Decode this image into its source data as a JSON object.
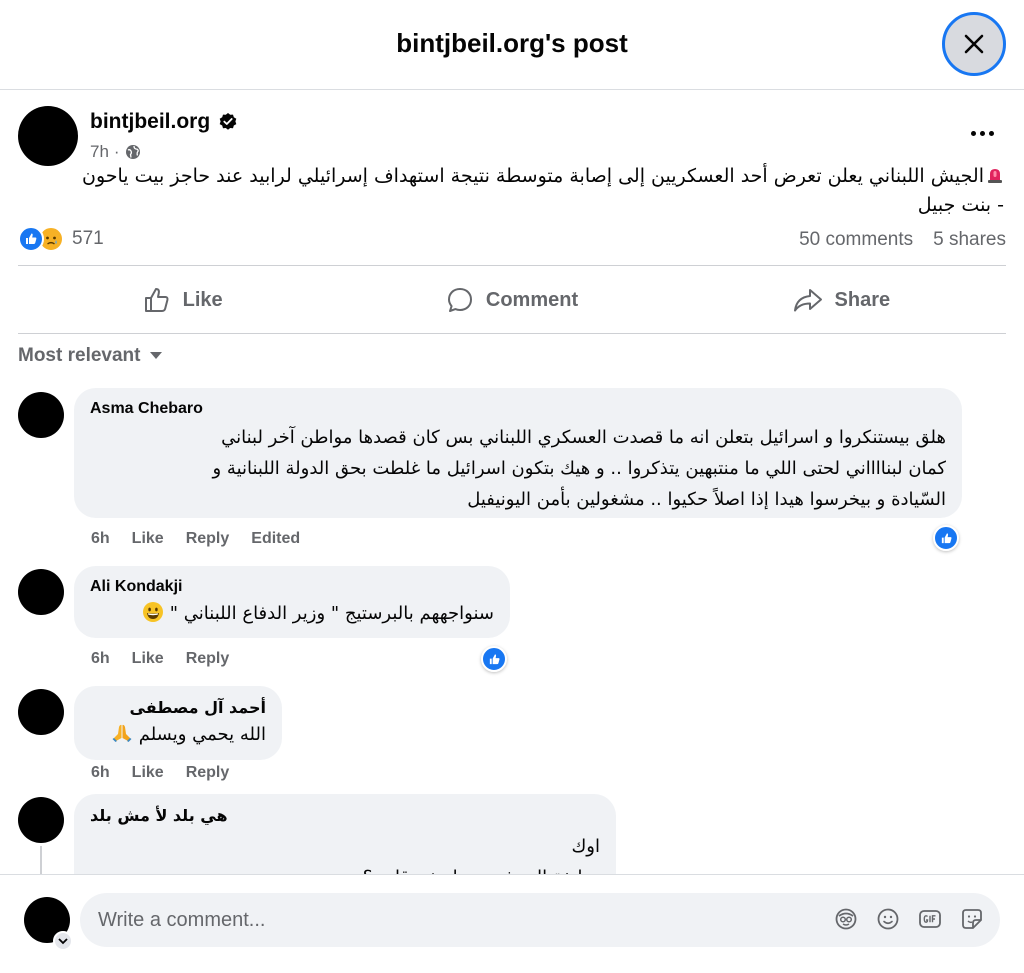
{
  "header": {
    "title": "bintjbeil.org's post"
  },
  "post": {
    "author": "bintjbeil.org",
    "time": "7h",
    "separator": "·",
    "text_line1": "الجيش اللبناني يعلن تعرض أحد العسكريين إلى إصابة متوسطة نتيجة استهداف إسرائيلي لرابيد عند حاجز بيت ياحون",
    "text_line2": "- بنت جبيل",
    "reaction_count": "571",
    "comments_count": "50 comments",
    "shares_count": "5 shares"
  },
  "actions": {
    "like": "Like",
    "comment": "Comment",
    "share": "Share"
  },
  "sort": {
    "label": "Most relevant"
  },
  "comments": [
    {
      "name": "Asma Chebaro",
      "lines": [
        "هلق بيستنكروا و اسرائيل بتعلن انه ما قصدت العسكري اللبناني بس كان قصدها مواطن آخر لبناني",
        "كمان لبنااااني لحتى اللي ما منتبهين يتذكروا .. و هيك بتكون اسرائيل ما غلطت بحق الدولة اللبنانية و",
        "السّيادة و بيخرسوا هيدا إذا اصلاً حكيوا .. مشغولين بأمن اليونيفيل"
      ],
      "time": "6h",
      "like": "Like",
      "reply": "Reply",
      "edited": "Edited"
    },
    {
      "name": "Ali Kondakji",
      "lines": [
        "سنواجههم بالبرستيج \" وزير الدفاع اللبناني \""
      ],
      "time": "6h",
      "like": "Like",
      "reply": "Reply"
    },
    {
      "name": "أحمد آل مصطفى",
      "lines": [
        "الله يحمي ويسلم"
      ],
      "time": "6h",
      "like": "Like",
      "reply": "Reply"
    },
    {
      "name": "هي بلد لأ مش بلد",
      "lines": [
        "اوك",
        "وظيفة الجيش يسجل خروقات ؟"
      ]
    }
  ],
  "composer": {
    "placeholder": "Write a comment..."
  },
  "colors": {
    "accent": "#1877f2",
    "muted": "#65676b",
    "bubble": "#f0f2f5"
  }
}
